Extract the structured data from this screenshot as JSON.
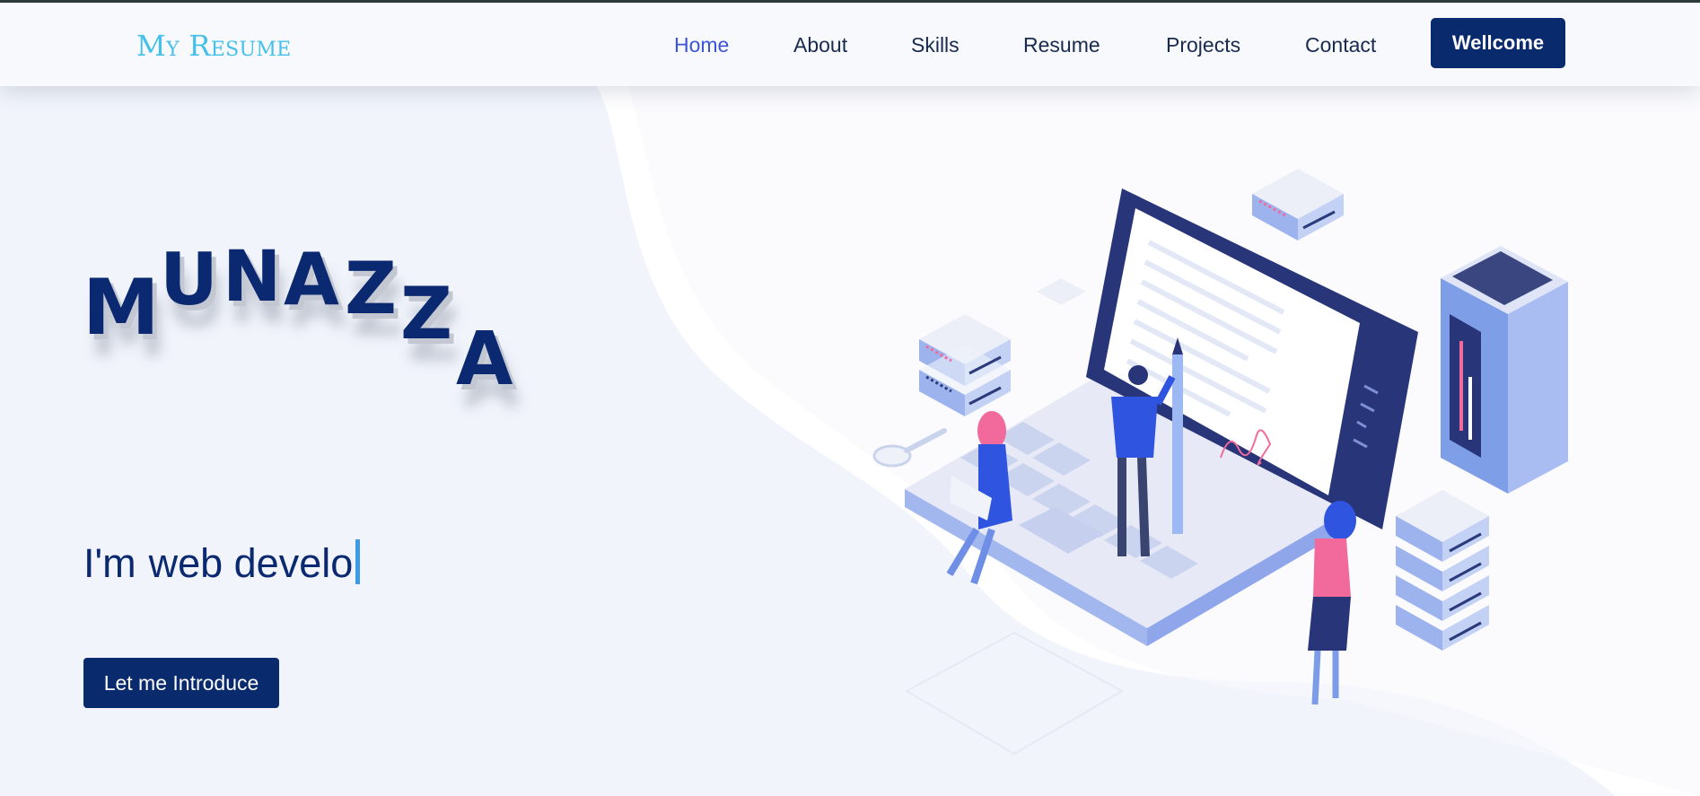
{
  "header": {
    "logo": "My Resume",
    "nav": [
      {
        "label": "Home",
        "active": true
      },
      {
        "label": "About",
        "active": false
      },
      {
        "label": "Skills",
        "active": false
      },
      {
        "label": "Resume",
        "active": false
      },
      {
        "label": "Projects",
        "active": false
      },
      {
        "label": "Contact",
        "active": false
      }
    ],
    "welcome_label": "Wellcome"
  },
  "hero": {
    "name_letters": [
      "M",
      "U",
      "N",
      "A",
      "Z",
      "Z",
      "A"
    ],
    "tagline_prefix": "I'm",
    "tagline_typed": "web develo",
    "intro_button_label": "Let me Introduce",
    "illustration_icon": "laptop-documents-illustration"
  },
  "colors": {
    "accent": "#45c0ea",
    "brand": "#0b2970",
    "nav_active": "#3c55d6",
    "caret": "#3d9be6",
    "background": "#f1f4fb"
  }
}
